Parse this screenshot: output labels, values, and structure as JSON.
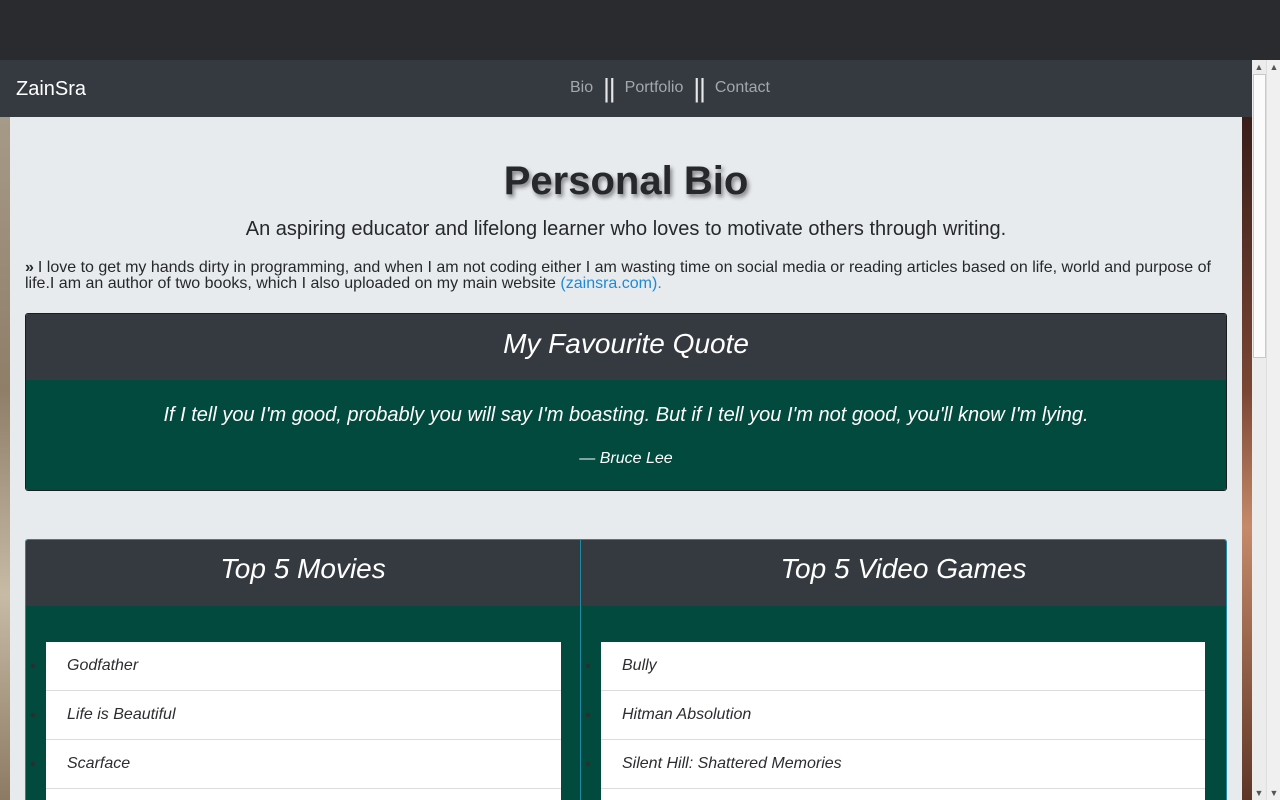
{
  "navbar": {
    "brand": "ZainSra",
    "links": [
      "Bio",
      "Portfolio",
      "Contact"
    ],
    "separator": "||"
  },
  "bio": {
    "title": "Personal Bio",
    "tagline": "An aspiring educator and lifelong learner who loves to motivate others through writing.",
    "paragraph": "I love to get my hands dirty in programming, and when I am not coding either I am wasting time on social media or reading articles based on life, world and purpose of life.I am an author of two books, which I also uploaded on my main website",
    "link_text": "(zainsra.com).",
    "bullet_icon": "double-chevron-right-icon"
  },
  "quote": {
    "heading": "My Favourite Quote",
    "text": "If I tell you I'm good, probably you will say I'm boasting. But if I tell you I'm not good, you'll know I'm lying.",
    "author": "— Bruce Lee"
  },
  "movies": {
    "heading": "Top 5 Movies",
    "items": [
      "Godfather",
      "Life is Beautiful",
      "Scarface"
    ]
  },
  "games": {
    "heading": "Top 5 Video Games",
    "items": [
      "Bully",
      "Hitman Absolution",
      "Silent Hill: Shattered Memories"
    ]
  },
  "colors": {
    "navbar": "#343a40",
    "card_body": "#024a3d",
    "link": "#1e8ad6",
    "page_bg": "#e8ebee"
  }
}
